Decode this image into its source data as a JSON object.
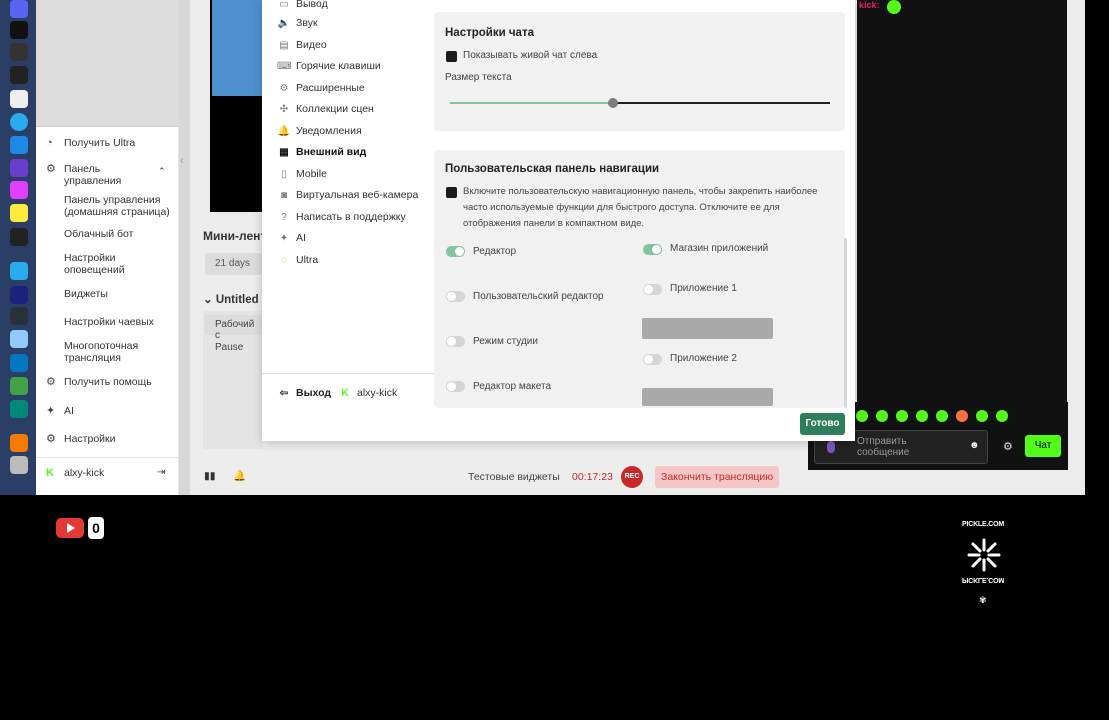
{
  "sidebar": {
    "items": [
      {
        "label": "Получить Ultra",
        "icon": "ultra-icon"
      },
      {
        "label": "Панель управления",
        "icon": "dashboard-icon"
      },
      {
        "label": "Панель управления (домашняя страница)"
      },
      {
        "label": "Облачный бот"
      },
      {
        "label": "Настройки оповещений"
      },
      {
        "label": "Виджеты"
      },
      {
        "label": "Настройки чаевых"
      },
      {
        "label": "Многопоточная трансляция"
      },
      {
        "label": "Получить помощь",
        "icon": "help-icon"
      },
      {
        "label": "AI",
        "icon": "ai-sparkle-icon"
      },
      {
        "label": "Настройки",
        "icon": "gear-icon"
      }
    ],
    "user": "alxy-kick"
  },
  "editor": {
    "mini_title": "Мини-лент",
    "days": "21 days",
    "untitled": "Untitled",
    "work_row": "Рабочий с",
    "pause": "Pause",
    "bottom": {
      "widgets_label": "Тестовые виджеты",
      "timer": "00:17:23",
      "rec": "REC",
      "end_stream": "Закончить трансляцию"
    }
  },
  "settings": {
    "nav": [
      {
        "label": "Вывод",
        "icon": "output-icon"
      },
      {
        "label": "Звук",
        "icon": "speaker-icon"
      },
      {
        "label": "Видео",
        "icon": "video-icon"
      },
      {
        "label": "Горячие клавиши",
        "icon": "keyboard-icon"
      },
      {
        "label": "Расширенные",
        "icon": "advanced-gear-icon"
      },
      {
        "label": "Коллекции сцен",
        "icon": "collections-icon"
      },
      {
        "label": "Уведомления",
        "icon": "bell-icon"
      },
      {
        "label": "Внешний вид",
        "icon": "appearance-icon",
        "active": true
      },
      {
        "label": "Mobile",
        "icon": "mobile-icon"
      },
      {
        "label": "Виртуальная веб-камера",
        "icon": "camera-icon"
      },
      {
        "label": "Написать в поддержку",
        "icon": "support-icon"
      },
      {
        "label": "AI",
        "icon": "ai-sparkle-icon"
      },
      {
        "label": "Ultra",
        "icon": "ultra-ring-icon"
      }
    ],
    "logout": "Выход",
    "account": "alxy-kick",
    "chat_settings": {
      "title": "Настройки чата",
      "live_chat_left": "Показывать живой чат слева",
      "text_size_label": "Размер текста",
      "text_size_fraction": 0.43
    },
    "custom_nav": {
      "title": "Пользовательская панель навигации",
      "description": "Включите пользовательскую навигационную панель, чтобы закрепить наиболее часто используемые функции для быстрого доступа. Отключите ее для отображения панели в компактном виде.",
      "toggles_left": [
        {
          "label": "Редактор",
          "on": true
        },
        {
          "label": "Пользовательский редактор",
          "on": false
        },
        {
          "label": "Режим студии",
          "on": false
        },
        {
          "label": "Редактор макета",
          "on": false
        }
      ],
      "toggles_right": [
        {
          "label": "Магазин приложений",
          "on": true
        },
        {
          "label": "Приложение 1",
          "on": false
        },
        {
          "label": "Приложение 2",
          "on": false
        }
      ]
    },
    "done": "Готово"
  },
  "chat": {
    "username": "kick",
    "input_placeholder": "Отправить сообщение",
    "send": "Чат"
  },
  "overlay": {
    "youtube_count": "0",
    "pickle_brand": "PICKLE.COM"
  },
  "colors": {
    "accent_green": "#80c4a0",
    "done_button": "#2e7d5b",
    "kick_green": "#53fc18",
    "rec_red": "#c62828"
  }
}
